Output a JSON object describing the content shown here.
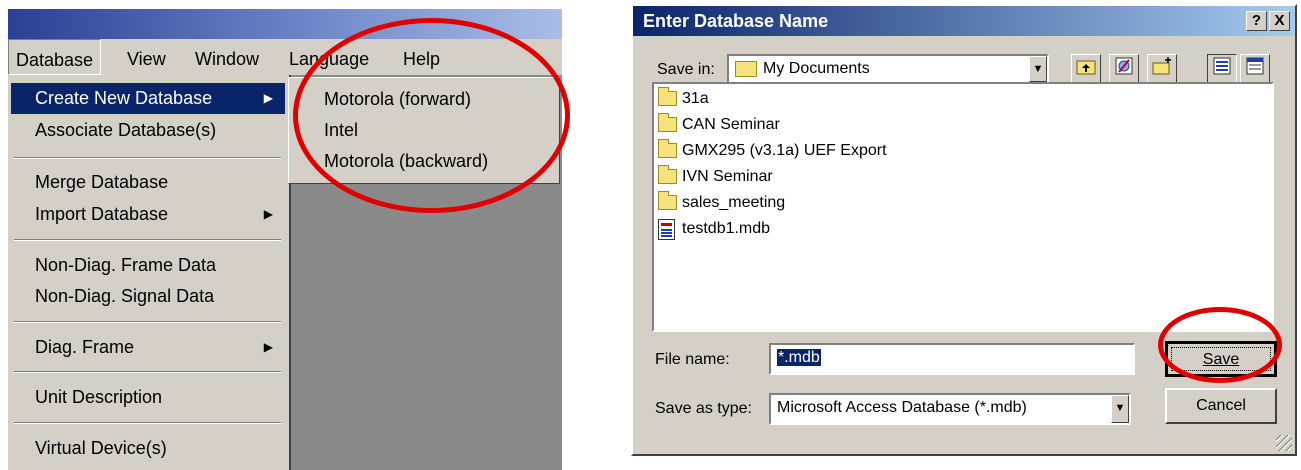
{
  "menu_window": {
    "menubar": [
      "Database",
      "View",
      "Window",
      "Language",
      "Help"
    ],
    "dropdown_items": [
      {
        "label": "Create New Database",
        "submenu": true,
        "highlighted": true
      },
      {
        "label": "Associate Database(s)",
        "submenu": false
      },
      {
        "label": "Merge Database",
        "submenu": false
      },
      {
        "label": "Import Database",
        "submenu": true
      },
      {
        "label": "Non-Diag. Frame Data",
        "submenu": false
      },
      {
        "label": "Non-Diag. Signal Data",
        "submenu": false
      },
      {
        "label": "Diag. Frame",
        "submenu": true
      },
      {
        "label": "Unit Description",
        "submenu": false
      },
      {
        "label": "Virtual Device(s)",
        "submenu": false
      }
    ],
    "submenu_items": [
      "Motorola (forward)",
      "Intel",
      "Motorola (backward)"
    ],
    "arrow_glyph": "▶"
  },
  "dialog": {
    "title": "Enter Database Name",
    "help_btn": "?",
    "close_btn": "X",
    "save_in_label": "Save in:",
    "save_in_value": "My Documents",
    "files": [
      {
        "name": "31a",
        "type": "folder"
      },
      {
        "name": "CAN Seminar",
        "type": "folder"
      },
      {
        "name": "GMX295 (v3.1a) UEF Export",
        "type": "folder"
      },
      {
        "name": "IVN Seminar",
        "type": "folder"
      },
      {
        "name": "sales_meeting",
        "type": "folder"
      },
      {
        "name": "testdb1.mdb",
        "type": "file"
      }
    ],
    "file_name_label": "File name:",
    "file_name_value": "*.mdb",
    "save_as_type_label": "Save as type:",
    "save_as_type_value": "Microsoft Access Database (*.mdb)",
    "save_button": "Save",
    "cancel_button": "Cancel"
  },
  "colors": {
    "highlight": "#0a246a",
    "annotation": "#e00000",
    "face": "#d4d0c8"
  }
}
